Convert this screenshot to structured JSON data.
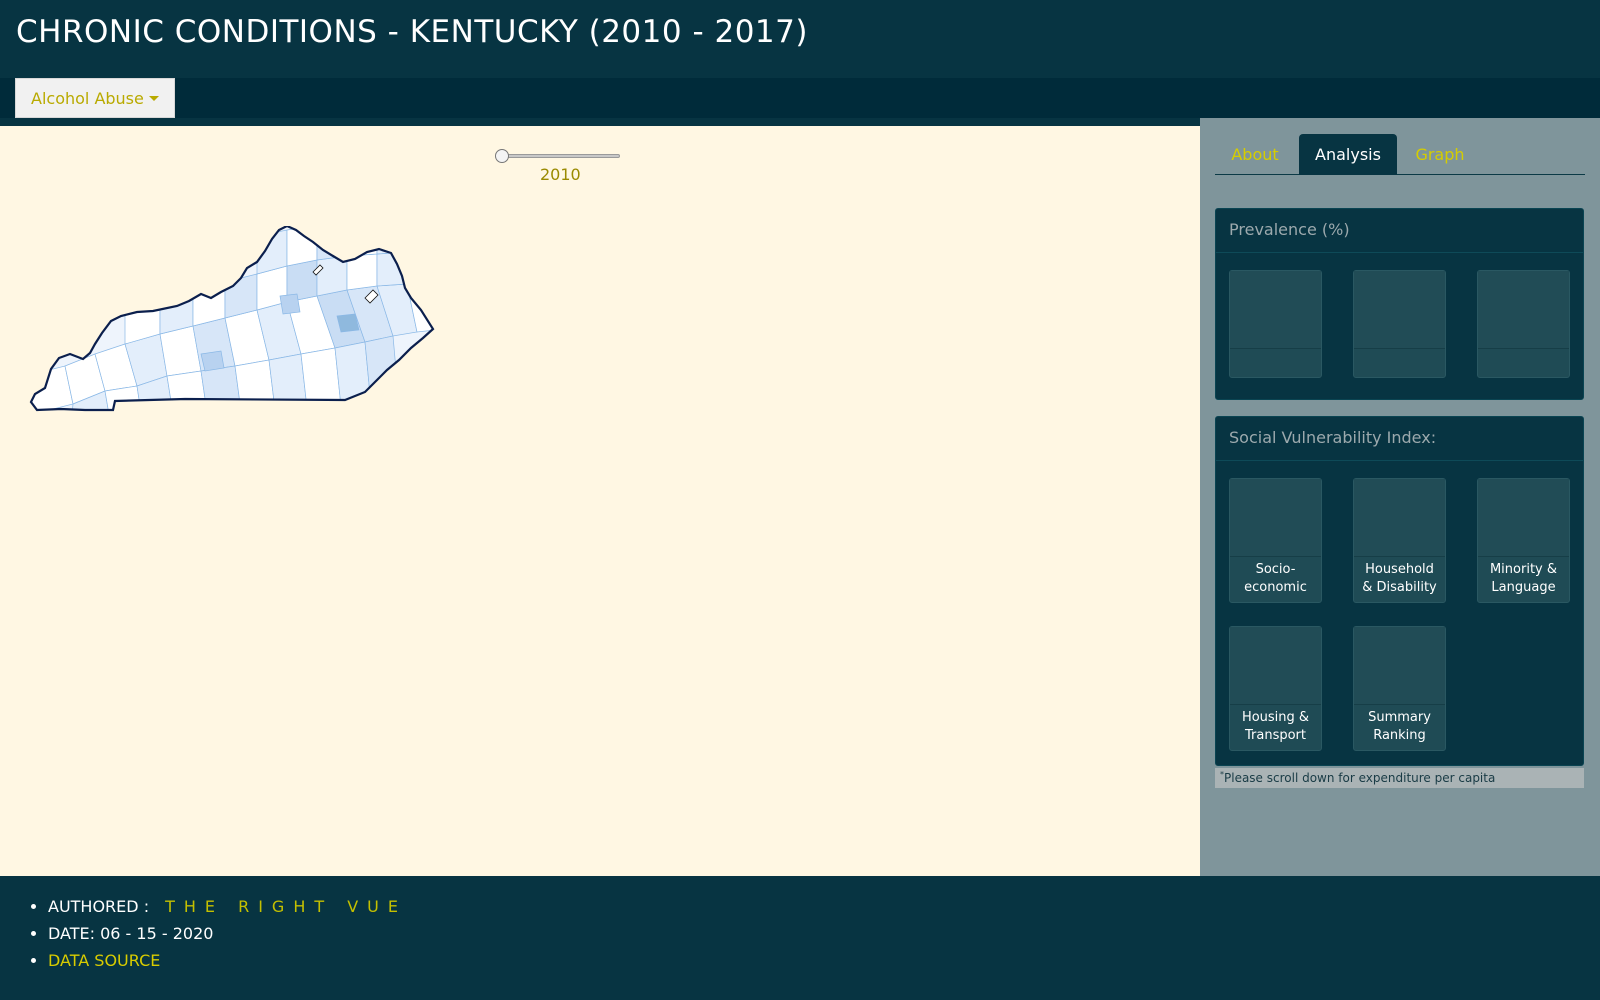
{
  "header": {
    "title": "CHRONIC CONDITIONS - KENTUCKY (2010 - 2017)"
  },
  "toolbar": {
    "condition_dropdown": "Alcohol Abuse"
  },
  "map": {
    "year": "2010",
    "year_progress": 0.0,
    "region": "Kentucky county choropleth"
  },
  "sidebar": {
    "tabs": [
      {
        "label": "About",
        "active": false
      },
      {
        "label": "Analysis",
        "active": true
      },
      {
        "label": "Graph",
        "active": false
      }
    ],
    "prevalence": {
      "title": "Prevalence (%)"
    },
    "svi": {
      "title": "Social Vulnerability Index:",
      "tiles": [
        {
          "line1": "Socio-",
          "line2": "economic"
        },
        {
          "line1": "Household",
          "line2": "& Disability"
        },
        {
          "line1": "Minority &",
          "line2": "Language"
        },
        {
          "line1": "Housing &",
          "line2": "Transport"
        },
        {
          "line1": "Summary",
          "line2": "Ranking"
        }
      ]
    },
    "note": {
      "mark": "*",
      "text": "Please scroll down for expenditure per capita"
    }
  },
  "footer": {
    "authored_label": "AUTHORED :",
    "authored_by": "THE RIGHT VUE",
    "date": "DATE: 06 - 15 - 2020",
    "data_source": "DATA SOURCE"
  },
  "colors": {
    "header_bg": "#073442",
    "map_bg": "#fff7e3",
    "accent_yellow": "#c4c000",
    "county_fill_light": "#e6effb",
    "county_fill_mid": "#c6dcf3",
    "county_stroke": "#7fb0e0"
  }
}
